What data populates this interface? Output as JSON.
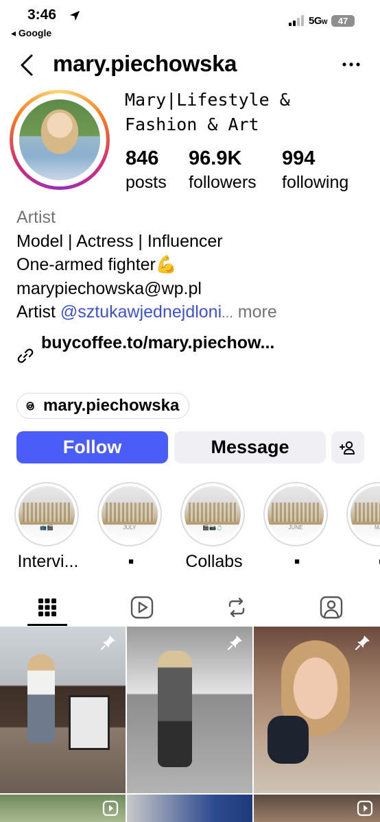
{
  "status_bar": {
    "time": "3:46",
    "back_app": "◂ Google",
    "network": "5G",
    "network_sub": "W",
    "battery": "47"
  },
  "header": {
    "username": "mary.piechowska"
  },
  "profile": {
    "display_name_line1": "Mary|Lifestyle &",
    "display_name_line2": "Fashion & Art",
    "stats": [
      {
        "number": "846",
        "label": "posts"
      },
      {
        "number": "96.9K",
        "label": "followers"
      },
      {
        "number": "994",
        "label": "following"
      }
    ]
  },
  "bio": {
    "category": "Artist",
    "line1": "Model | Actress | Influencer",
    "line2": "One-armed fighter",
    "line2_emoji": "💪",
    "line3": "marypiechowska@wp.pl",
    "line4_prefix": "Artist ",
    "mention": "@sztukawjednejdloni",
    "ellipsis": "...",
    "more": " more",
    "link": "buycoffee.to/mary.piechow..."
  },
  "threads": {
    "handle": "mary.piechowska"
  },
  "actions": {
    "follow": "Follow",
    "message": "Message"
  },
  "highlights": [
    {
      "label": "Intervi...",
      "mark": "📺🎬"
    },
    {
      "label": "▪",
      "mark": "JULY"
    },
    {
      "label": "Collabs",
      "mark": "🎬📷💍"
    },
    {
      "label": "▪",
      "mark": "JUNE"
    },
    {
      "label": "▪",
      "mark": "MA"
    }
  ],
  "colors": {
    "follow_bg": "#4a5df9",
    "mention": "#3b52d8",
    "secondary_text": "#737373",
    "button_bg": "#efeff4"
  }
}
